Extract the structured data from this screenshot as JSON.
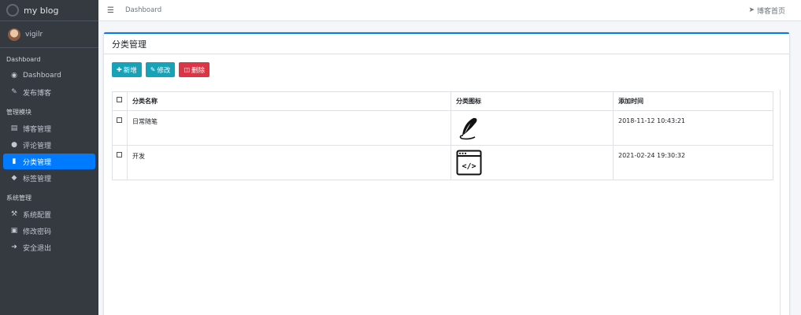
{
  "brand": {
    "title": "my blog"
  },
  "user": {
    "name": "vigilr"
  },
  "sidebar": {
    "sections": [
      {
        "header": "Dashboard",
        "items": [
          {
            "label": "Dashboard",
            "icon": "tachometer-icon"
          },
          {
            "label": "发布博客",
            "icon": "edit-icon"
          }
        ]
      },
      {
        "header": "管理模块",
        "items": [
          {
            "label": "博客管理",
            "icon": "list-icon"
          },
          {
            "label": "评论管理",
            "icon": "comments-icon"
          },
          {
            "label": "分类管理",
            "icon": "bookmark-icon",
            "active": true
          },
          {
            "label": "标签管理",
            "icon": "tags-icon"
          }
        ]
      },
      {
        "header": "系统管理",
        "items": [
          {
            "label": "系统配置",
            "icon": "wrench-icon"
          },
          {
            "label": "修改密码",
            "icon": "lock-icon"
          },
          {
            "label": "安全退出",
            "icon": "sign-out-icon"
          }
        ]
      }
    ]
  },
  "topbar": {
    "breadcrumb": "Dashboard",
    "home_link": "博客首页"
  },
  "card": {
    "title": "分类管理"
  },
  "toolbar": {
    "add_label": "新增",
    "edit_label": "修改",
    "delete_label": "删除"
  },
  "table": {
    "headers": {
      "name": "分类名称",
      "icon": "分类图标",
      "time": "添加时间"
    },
    "rows": [
      {
        "name": "日常随笔",
        "icon": "quill-icon",
        "time": "2018-11-12 10:43:21"
      },
      {
        "name": "开发",
        "icon": "code-window-icon",
        "time": "2021-02-24 19:30:32"
      }
    ]
  },
  "colors": {
    "sidebar_bg": "#343a40",
    "accent": "#007bff",
    "info": "#17a2b8",
    "danger": "#dc3545"
  }
}
